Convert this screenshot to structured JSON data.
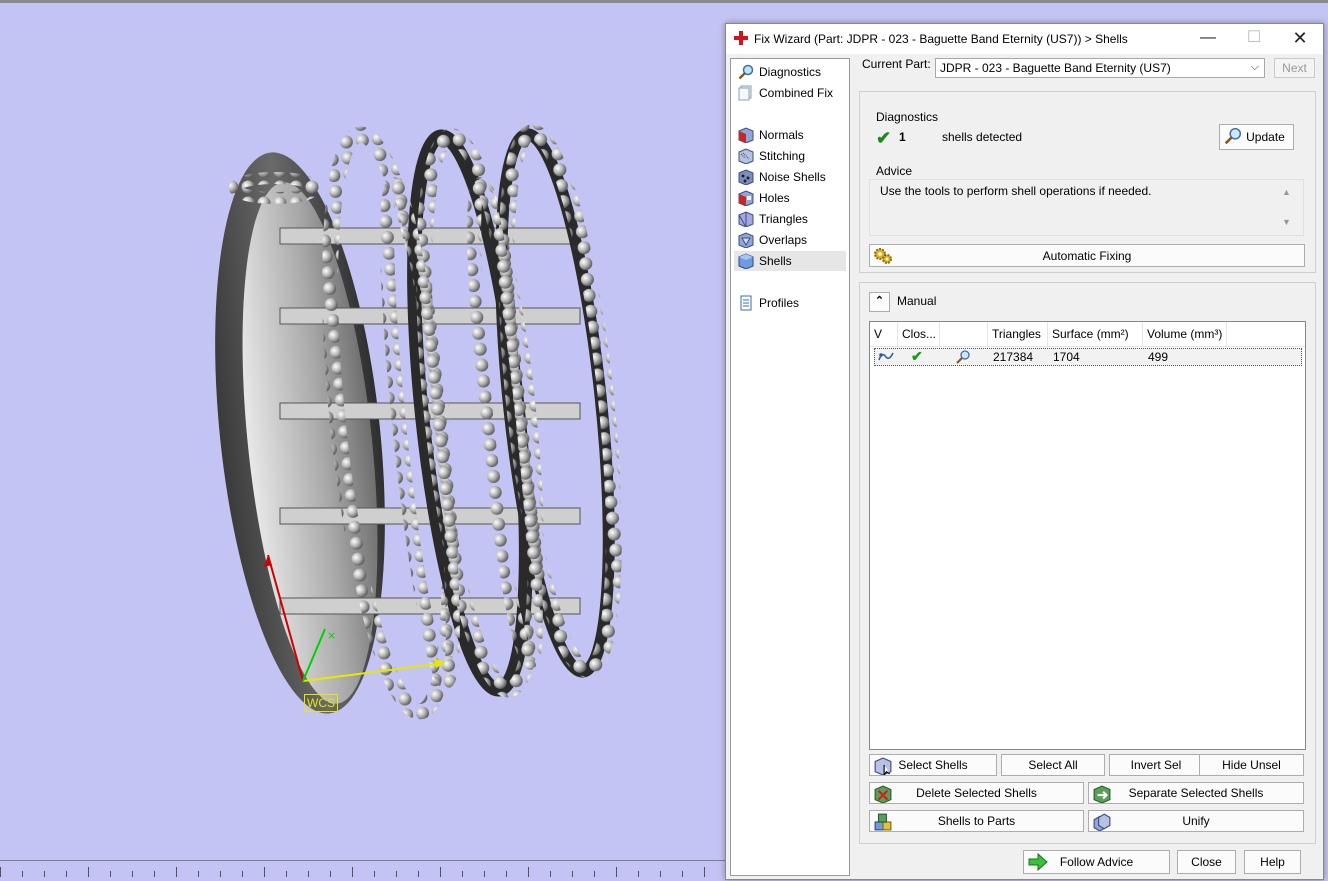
{
  "window": {
    "title": "Fix Wizard (Part: JDPR - 023 - Baguette Band Eternity (US7)) > Shells",
    "minimize": "—",
    "maximize": "☐",
    "close": "✕"
  },
  "viewport": {
    "axis_label": "WCS",
    "axis_colors": {
      "x": "#e8e800",
      "y": "#00d000",
      "z": "#d00000"
    },
    "background": "#c4c4f4"
  },
  "sidebar": {
    "items": [
      {
        "label": "Diagnostics",
        "icon": "magnifier-icon"
      },
      {
        "label": "Combined Fix",
        "icon": "combined-fix-icon"
      },
      {
        "label": "Normals",
        "icon": "normals-cube-icon"
      },
      {
        "label": "Stitching",
        "icon": "stitching-cube-icon"
      },
      {
        "label": "Noise Shells",
        "icon": "noise-shells-icon"
      },
      {
        "label": "Holes",
        "icon": "holes-cube-icon"
      },
      {
        "label": "Triangles",
        "icon": "triangles-cube-icon"
      },
      {
        "label": "Overlaps",
        "icon": "overlaps-cube-icon"
      },
      {
        "label": "Shells",
        "icon": "shells-cube-icon",
        "active": true
      },
      {
        "label": "Profiles",
        "icon": "profiles-doc-icon"
      }
    ]
  },
  "part": {
    "label": "Current Part:",
    "value": "JDPR - 023 - Baguette Band Eternity (US7)",
    "next": "Next"
  },
  "diagnostics": {
    "title": "Diagnostics",
    "count": "1",
    "text": "shells detected",
    "update": "Update"
  },
  "advice": {
    "title": "Advice",
    "text": "Use the tools to perform shell operations if needed."
  },
  "automatic_fixing": "Automatic Fixing",
  "manual": {
    "label": "Manual",
    "columns": [
      "V",
      "Clos...",
      "",
      "Triangles",
      "Surface (mm²)",
      "Volume (mm³)"
    ],
    "rows": [
      {
        "triangles": "217384",
        "surface": "1704",
        "volume": "499"
      }
    ],
    "buttons": {
      "select_shells": "Select Shells",
      "select_all": "Select All",
      "invert_sel": "Invert Sel",
      "hide_unsel": "Hide Unsel",
      "delete_selected": "Delete Selected Shells",
      "separate_selected": "Separate Selected Shells",
      "shells_to_parts": "Shells to Parts",
      "unify": "Unify"
    }
  },
  "footer": {
    "follow_advice": "Follow Advice",
    "close": "Close",
    "help": "Help"
  }
}
